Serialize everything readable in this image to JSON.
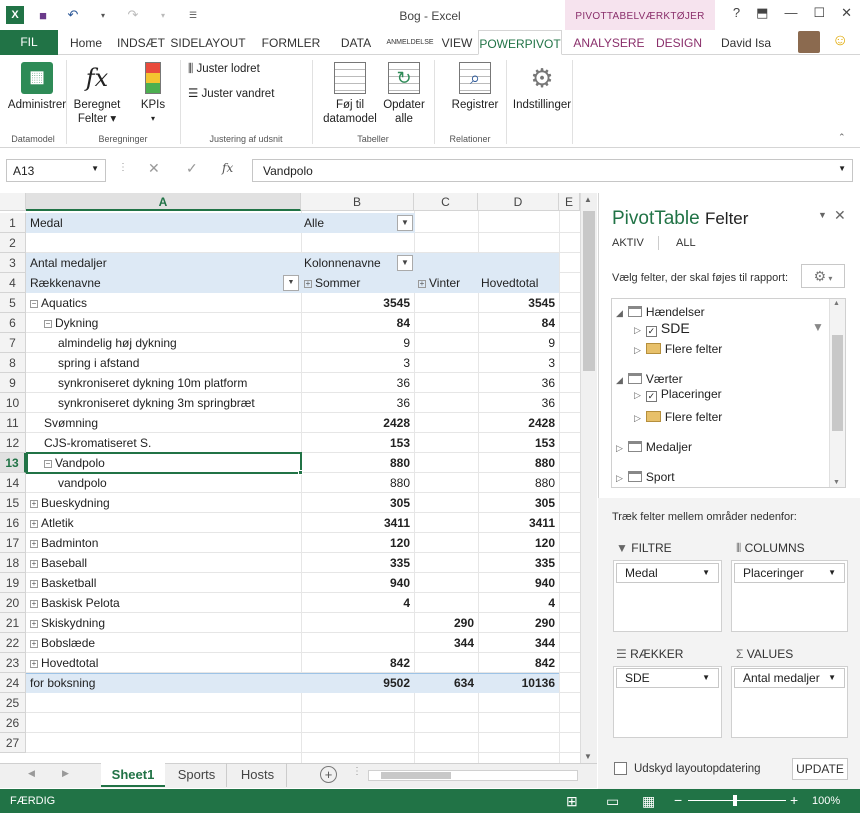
{
  "window": {
    "title": "Bog - Excel",
    "context_title": "PIVOTTABELVÆRKTØJER",
    "help": "?",
    "user": "David Isa",
    "smiley": "☺"
  },
  "tabs": [
    "FIL",
    "Home",
    "INDSÆT",
    "SIDELAYOUT",
    "FORMLER",
    "DATA",
    "ANMELDELSE",
    "VIEW",
    "POWERPIVOT",
    "ANALYSERE",
    "DESIGN"
  ],
  "ribbon": {
    "administrer": "Administrer",
    "beregnet_felter_1": "Beregnet",
    "beregnet_felter_2": "Felter",
    "kpis": "KPIs",
    "juster_lodret": "Juster lodret",
    "juster_vandret": "Juster vandret",
    "foj_til_1": "Føj til",
    "foj_til_2": "datamodel",
    "opdater_1": "Opdater",
    "opdater_2": "alle",
    "registrer": "Registrer",
    "indstillinger": "Indstillinger",
    "groups": {
      "datamodel": "Datamodel",
      "beregninger": "Beregninger",
      "justering": "Justering af udsnit",
      "tabeller": "Tabeller",
      "relationer": "Relationer"
    }
  },
  "formula": {
    "namebox": "A13",
    "value": "Vandpolo",
    "fx": "fx"
  },
  "columns": [
    "A",
    "B",
    "C",
    "D",
    "E"
  ],
  "rows": [
    "1",
    "2",
    "3",
    "4",
    "5",
    "6",
    "7",
    "8",
    "9",
    "10",
    "11",
    "12",
    "13",
    "14",
    "15",
    "16",
    "17",
    "18",
    "19",
    "20",
    "21",
    "22",
    "23",
    "24",
    "25",
    "26",
    "27"
  ],
  "pivot": {
    "r1_a": "Medal",
    "r1_b": "Alle",
    "r3_a": "Antal medaljer",
    "r3_b": "Kolonnenavne",
    "r4_a": "Rækkenavne",
    "r4_b": "Sommer",
    "r4_c": "Vinter",
    "r4_d": "Hovedtotal",
    "body": [
      {
        "label": "Aquatics",
        "indent": 0,
        "exp": "−",
        "b": "3545",
        "c": "",
        "d": "3545",
        "bold": true
      },
      {
        "label": "Dykning",
        "indent": 1,
        "exp": "−",
        "b": "84",
        "c": "",
        "d": "84",
        "bold": true
      },
      {
        "label": "almindelig høj dykning",
        "indent": 2,
        "exp": "",
        "b": "9",
        "c": "",
        "d": "9",
        "bold": false
      },
      {
        "label": "spring i afstand",
        "indent": 2,
        "exp": "",
        "b": "3",
        "c": "",
        "d": "3",
        "bold": false
      },
      {
        "label": "synkroniseret dykning 10m platform",
        "indent": 2,
        "exp": "",
        "b": "36",
        "c": "",
        "d": "36",
        "bold": false
      },
      {
        "label": "synkroniseret dykning 3m springbræt",
        "indent": 2,
        "exp": "",
        "b": "36",
        "c": "",
        "d": "36",
        "bold": false
      },
      {
        "label": "Svømning",
        "indent": 1,
        "exp": "",
        "b": "2428",
        "c": "",
        "d": "2428",
        "bold": true
      },
      {
        "label": "CJS-kromatiseret S.",
        "indent": 1,
        "exp": "",
        "b": "153",
        "c": "",
        "d": "153",
        "bold": true
      },
      {
        "label": "Vandpolo",
        "indent": 1,
        "exp": "−",
        "b": "880",
        "c": "",
        "d": "880",
        "bold": true
      },
      {
        "label": "vandpolo",
        "indent": 2,
        "exp": "",
        "b": "880",
        "c": "",
        "d": "880",
        "bold": false
      },
      {
        "label": "Bueskydning",
        "indent": 0,
        "exp": "+",
        "b": "305",
        "c": "",
        "d": "305",
        "bold": true
      },
      {
        "label": "Atletik",
        "indent": 0,
        "exp": "+",
        "b": "3411",
        "c": "",
        "d": "3411",
        "bold": true
      },
      {
        "label": "Badminton",
        "indent": 0,
        "exp": "+",
        "b": "120",
        "c": "",
        "d": "120",
        "bold": true
      },
      {
        "label": "Baseball",
        "indent": 0,
        "exp": "+",
        "b": "335",
        "c": "",
        "d": "335",
        "bold": true
      },
      {
        "label": "Basketball",
        "indent": 0,
        "exp": "+",
        "b": "940",
        "c": "",
        "d": "940",
        "bold": true
      },
      {
        "label": "Baskisk Pelota",
        "indent": 0,
        "exp": "+",
        "b": "4",
        "c": "",
        "d": "4",
        "bold": true
      },
      {
        "label": "Skiskydning",
        "indent": 0,
        "exp": "+",
        "b": "",
        "c": "290",
        "d": "290",
        "bold": true
      },
      {
        "label": "Bobslæde",
        "indent": 0,
        "exp": "+",
        "b": "",
        "c": "344",
        "d": "344",
        "bold": true
      },
      {
        "label": "Hovedtotal",
        "indent": 0,
        "exp": "+",
        "b": "842",
        "c": "",
        "d": "842",
        "bold": true
      },
      {
        "label": "for boksning",
        "indent": 0,
        "exp": "",
        "b": "9502",
        "c": "634",
        "d": "10136",
        "bold": true
      }
    ]
  },
  "sheets": [
    "Sheet1",
    "Sports",
    "Hosts"
  ],
  "status": {
    "ready": "FÆRDIG",
    "zoom": "100%"
  },
  "pane": {
    "title_1": "PivotTable",
    "title_2": "Felter",
    "tab_active": "AKTIV",
    "tab_all": "ALL",
    "choose": "Vælg felter, der skal føjes til rapport:",
    "tables": {
      "haendelser": "Hændelser",
      "sde": "SDE",
      "flere1": "Flere felter",
      "vaerter": "Værter",
      "placeringer": "Placeringer",
      "flere2": "Flere felter",
      "medaljer": "Medaljer",
      "sport": "Sport"
    },
    "drag_label": "Træk felter mellem områder nedenfor:",
    "areas": {
      "filtre": "FILTRE",
      "columns": "COLUMNS",
      "raekker": "RÆKKER",
      "values": "VALUES",
      "filtre_val": "Medal",
      "columns_val": "Placeringer",
      "raekker_val": "SDE",
      "values_val": "Antal medaljer"
    },
    "defer": "Udskyd layoutopdatering",
    "update": "UPDATE"
  }
}
